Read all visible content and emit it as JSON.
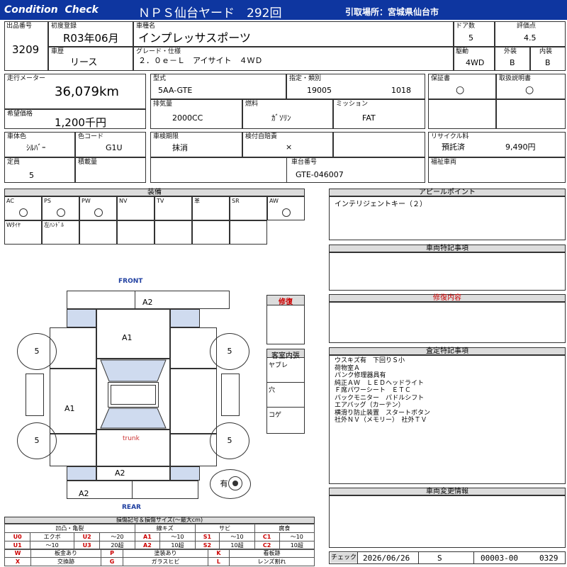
{
  "header": {
    "title": "Condition  Check",
    "yard": "ＮＰＳ仙台ヤード　292回",
    "pickup": "引取場所：宮城県仙台市"
  },
  "row1": {
    "lot_label": "出品番号",
    "lot": "3209",
    "first_reg_label": "初度登録",
    "first_reg": "R03年06月",
    "car_name_label": "車種名",
    "car_name": "インプレッサスポーツ",
    "doors_label": "ドア数",
    "doors": "5",
    "score_label": "評価点",
    "score": "4.5",
    "history_label": "車歴",
    "history": "リース",
    "grade_label": "グレード・仕様",
    "grade": "２．０ｅ－Ｌ　アイサイト　４ＷＤ",
    "drive_label": "駆動",
    "drive": "4WD",
    "exterior_label": "外装",
    "exterior": "B",
    "interior_label": "内装",
    "interior": "B"
  },
  "row2": {
    "mileage_label": "走行メーター",
    "mileage": "36,079km",
    "model_label": "型式",
    "model": "5AA-GTE",
    "designation_label": "指定・類別",
    "designation_a": "19005",
    "designation_b": "1018",
    "warranty_label": "保証書",
    "warranty": "○",
    "manual_label": "取扱説明書",
    "manual": "○",
    "price_label": "希望価格",
    "price": "1,200千円",
    "displacement_label": "排気量",
    "displacement": "2000CC",
    "fuel_label": "燃料",
    "fuel": "ｶﾞｿﾘﾝ",
    "mission_label": "ミッション",
    "mission": "FAT"
  },
  "row3": {
    "color_label": "車体色",
    "color": "ｼﾙﾊﾞｰ",
    "color_code_label": "色コード",
    "color_code": "G1U",
    "inspection_label": "車検期限",
    "inspection": "抹消",
    "insurance_label": "検付自賠責",
    "insurance": "×",
    "recycle_label": "リサイクル料",
    "recycle_status": "預託済",
    "recycle_fee": "9,490円",
    "capacity_label": "定員",
    "capacity": "5",
    "load_label": "積載量",
    "load": "",
    "chassis_label": "車台番号",
    "chassis": "GTE-046007",
    "welfare_label": "福祉車両",
    "welfare": ""
  },
  "equipment": {
    "title": "装備",
    "row1": [
      {
        "label": "AC",
        "mark": "○"
      },
      {
        "label": "PS",
        "mark": "○"
      },
      {
        "label": "PW",
        "mark": "○"
      },
      {
        "label": "NV",
        "mark": ""
      },
      {
        "label": "TV",
        "mark": ""
      },
      {
        "label": "革",
        "mark": ""
      },
      {
        "label": "SR",
        "mark": ""
      },
      {
        "label": "AW",
        "mark": "○"
      }
    ],
    "row2": [
      {
        "label": "Wﾀｲﾔ"
      },
      {
        "label": "左ﾊﾝﾄﾞﾙ"
      },
      {
        "label": ""
      },
      {
        "label": ""
      },
      {
        "label": ""
      },
      {
        "label": ""
      },
      {
        "label": ""
      }
    ]
  },
  "diagram": {
    "front": "FRONT",
    "rear": "REAR",
    "trunk": "trunk",
    "codes": {
      "top_a2": "A2",
      "a1_hood": "A1",
      "a1_left": "A1",
      "a2_rear": "A2",
      "a2_bottom": "A2"
    },
    "tires": {
      "fl": "5",
      "fr": "5",
      "rl": "5",
      "rr": "5"
    },
    "spare": "有"
  },
  "repair_box": {
    "title": "修復"
  },
  "cabin": {
    "title": "客室内張",
    "items": [
      "ヤブレ",
      "穴",
      "コゲ"
    ]
  },
  "panels": {
    "appeal_title": "アピールポイント",
    "appeal": "インテリジェントキー（２）",
    "special_title": "車両特記事項",
    "repair_title": "修復内容",
    "inspect_title": "査定特記事項",
    "inspect_lines": [
      "ウスキズ有　下回りＳ小",
      "荷物室Ａ",
      "パンク修理器具有",
      "純正ＡＷ　ＬＥＤヘッドライト",
      "Ｆ席パワーシート　ＥＴＣ",
      "バックモニター　パドルシフト",
      "エアバッグ（カーテン）",
      "横滑り防止装置　スタートボタン",
      "社外ＮＶ（メモリー）　社外ＴＶ"
    ],
    "change_title": "車両変更情報"
  },
  "legend": {
    "title": "損傷記号＆損傷サイズ(〜最大cm)",
    "g1": "凹凸・亀裂",
    "g2": "線キズ",
    "g3": "サビ",
    "g4": "腐食",
    "row_a": [
      "U0",
      "エクボ",
      "U2",
      "〜20",
      "A1",
      "〜10",
      "S1",
      "〜10",
      "C1",
      "〜10"
    ],
    "row_b": [
      "U1",
      "〜10",
      "U3",
      "20超",
      "A2",
      "10超",
      "S2",
      "10超",
      "C2",
      "10超"
    ],
    "row_c": [
      "W",
      "板金あり",
      "P",
      "塗装あり",
      "K",
      "看板跡"
    ],
    "row_d": [
      "X",
      "交換跡",
      "G",
      "ガラスヒビ",
      "L",
      "レンズ割れ"
    ]
  },
  "footer": {
    "check_label": "チェック",
    "date": "2026/06/26",
    "inspector": "S",
    "code": "00003-00",
    "number": "0329"
  },
  "colors": {
    "header_bar": "#0e36a0",
    "blue_tint": "#cfdbef",
    "gray_bar": "#d9d9d9",
    "red_text": "#cc0000"
  }
}
